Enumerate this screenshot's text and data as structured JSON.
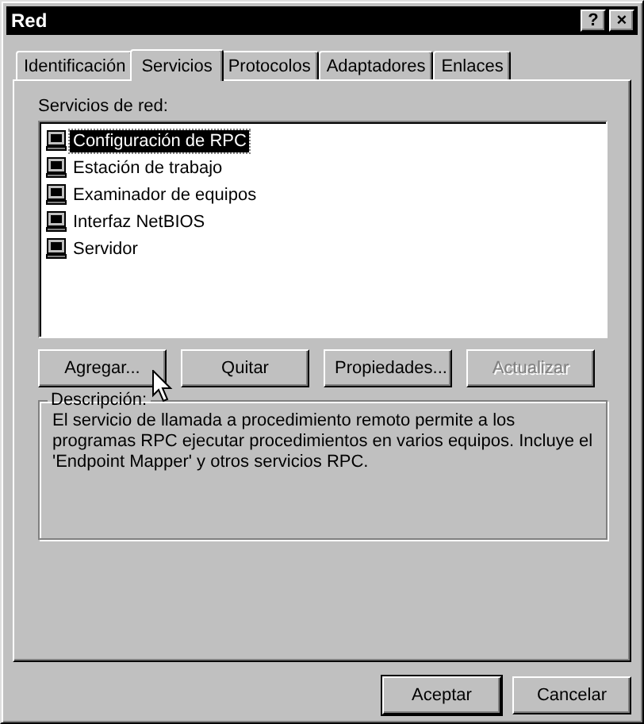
{
  "window": {
    "title": "Red",
    "title_buttons": [
      "?",
      "×"
    ]
  },
  "tabs": [
    {
      "label": "Identificación",
      "selected": false
    },
    {
      "label": "Servicios",
      "selected": true
    },
    {
      "label": "Protocolos",
      "selected": false
    },
    {
      "label": "Adaptadores",
      "selected": false
    },
    {
      "label": "Enlaces",
      "selected": false
    }
  ],
  "services": {
    "label": "Servicios de red:",
    "items": [
      {
        "label": "Configuración de RPC",
        "selected": true
      },
      {
        "label": "Estación de trabajo",
        "selected": false
      },
      {
        "label": "Examinador de equipos",
        "selected": false
      },
      {
        "label": "Interfaz NetBIOS",
        "selected": false
      },
      {
        "label": "Servidor",
        "selected": false
      }
    ]
  },
  "actions": [
    {
      "label": "Agregar...",
      "disabled": false
    },
    {
      "label": "Quitar",
      "disabled": false
    },
    {
      "label": "Propiedades...",
      "disabled": false
    },
    {
      "label": "Actualizar",
      "disabled": true
    }
  ],
  "description": {
    "label": "Descripción:",
    "text": "El servicio de llamada a procedimiento remoto permite a los programas RPC ejecutar procedimientos en varios equipos. Incluye el 'Endpoint Mapper' y otros servicios RPC."
  },
  "dialog_buttons": [
    {
      "label": "Aceptar",
      "default": true
    },
    {
      "label": "Cancelar",
      "default": false
    }
  ]
}
